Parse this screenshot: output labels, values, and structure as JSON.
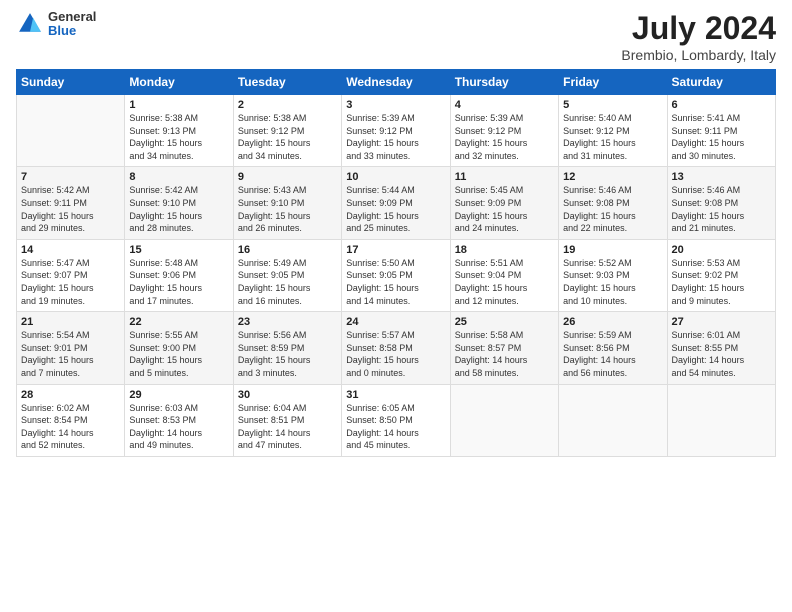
{
  "header": {
    "logo": {
      "line1": "General",
      "line2": "Blue"
    },
    "title": "July 2024",
    "location": "Brembio, Lombardy, Italy"
  },
  "days_of_week": [
    "Sunday",
    "Monday",
    "Tuesday",
    "Wednesday",
    "Thursday",
    "Friday",
    "Saturday"
  ],
  "weeks": [
    [
      {
        "day": "",
        "content": ""
      },
      {
        "day": "1",
        "content": "Sunrise: 5:38 AM\nSunset: 9:13 PM\nDaylight: 15 hours\nand 34 minutes."
      },
      {
        "day": "2",
        "content": "Sunrise: 5:38 AM\nSunset: 9:12 PM\nDaylight: 15 hours\nand 34 minutes."
      },
      {
        "day": "3",
        "content": "Sunrise: 5:39 AM\nSunset: 9:12 PM\nDaylight: 15 hours\nand 33 minutes."
      },
      {
        "day": "4",
        "content": "Sunrise: 5:39 AM\nSunset: 9:12 PM\nDaylight: 15 hours\nand 32 minutes."
      },
      {
        "day": "5",
        "content": "Sunrise: 5:40 AM\nSunset: 9:12 PM\nDaylight: 15 hours\nand 31 minutes."
      },
      {
        "day": "6",
        "content": "Sunrise: 5:41 AM\nSunset: 9:11 PM\nDaylight: 15 hours\nand 30 minutes."
      }
    ],
    [
      {
        "day": "7",
        "content": "Sunrise: 5:42 AM\nSunset: 9:11 PM\nDaylight: 15 hours\nand 29 minutes."
      },
      {
        "day": "8",
        "content": "Sunrise: 5:42 AM\nSunset: 9:10 PM\nDaylight: 15 hours\nand 28 minutes."
      },
      {
        "day": "9",
        "content": "Sunrise: 5:43 AM\nSunset: 9:10 PM\nDaylight: 15 hours\nand 26 minutes."
      },
      {
        "day": "10",
        "content": "Sunrise: 5:44 AM\nSunset: 9:09 PM\nDaylight: 15 hours\nand 25 minutes."
      },
      {
        "day": "11",
        "content": "Sunrise: 5:45 AM\nSunset: 9:09 PM\nDaylight: 15 hours\nand 24 minutes."
      },
      {
        "day": "12",
        "content": "Sunrise: 5:46 AM\nSunset: 9:08 PM\nDaylight: 15 hours\nand 22 minutes."
      },
      {
        "day": "13",
        "content": "Sunrise: 5:46 AM\nSunset: 9:08 PM\nDaylight: 15 hours\nand 21 minutes."
      }
    ],
    [
      {
        "day": "14",
        "content": "Sunrise: 5:47 AM\nSunset: 9:07 PM\nDaylight: 15 hours\nand 19 minutes."
      },
      {
        "day": "15",
        "content": "Sunrise: 5:48 AM\nSunset: 9:06 PM\nDaylight: 15 hours\nand 17 minutes."
      },
      {
        "day": "16",
        "content": "Sunrise: 5:49 AM\nSunset: 9:05 PM\nDaylight: 15 hours\nand 16 minutes."
      },
      {
        "day": "17",
        "content": "Sunrise: 5:50 AM\nSunset: 9:05 PM\nDaylight: 15 hours\nand 14 minutes."
      },
      {
        "day": "18",
        "content": "Sunrise: 5:51 AM\nSunset: 9:04 PM\nDaylight: 15 hours\nand 12 minutes."
      },
      {
        "day": "19",
        "content": "Sunrise: 5:52 AM\nSunset: 9:03 PM\nDaylight: 15 hours\nand 10 minutes."
      },
      {
        "day": "20",
        "content": "Sunrise: 5:53 AM\nSunset: 9:02 PM\nDaylight: 15 hours\nand 9 minutes."
      }
    ],
    [
      {
        "day": "21",
        "content": "Sunrise: 5:54 AM\nSunset: 9:01 PM\nDaylight: 15 hours\nand 7 minutes."
      },
      {
        "day": "22",
        "content": "Sunrise: 5:55 AM\nSunset: 9:00 PM\nDaylight: 15 hours\nand 5 minutes."
      },
      {
        "day": "23",
        "content": "Sunrise: 5:56 AM\nSunset: 8:59 PM\nDaylight: 15 hours\nand 3 minutes."
      },
      {
        "day": "24",
        "content": "Sunrise: 5:57 AM\nSunset: 8:58 PM\nDaylight: 15 hours\nand 0 minutes."
      },
      {
        "day": "25",
        "content": "Sunrise: 5:58 AM\nSunset: 8:57 PM\nDaylight: 14 hours\nand 58 minutes."
      },
      {
        "day": "26",
        "content": "Sunrise: 5:59 AM\nSunset: 8:56 PM\nDaylight: 14 hours\nand 56 minutes."
      },
      {
        "day": "27",
        "content": "Sunrise: 6:01 AM\nSunset: 8:55 PM\nDaylight: 14 hours\nand 54 minutes."
      }
    ],
    [
      {
        "day": "28",
        "content": "Sunrise: 6:02 AM\nSunset: 8:54 PM\nDaylight: 14 hours\nand 52 minutes."
      },
      {
        "day": "29",
        "content": "Sunrise: 6:03 AM\nSunset: 8:53 PM\nDaylight: 14 hours\nand 49 minutes."
      },
      {
        "day": "30",
        "content": "Sunrise: 6:04 AM\nSunset: 8:51 PM\nDaylight: 14 hours\nand 47 minutes."
      },
      {
        "day": "31",
        "content": "Sunrise: 6:05 AM\nSunset: 8:50 PM\nDaylight: 14 hours\nand 45 minutes."
      },
      {
        "day": "",
        "content": ""
      },
      {
        "day": "",
        "content": ""
      },
      {
        "day": "",
        "content": ""
      }
    ]
  ]
}
